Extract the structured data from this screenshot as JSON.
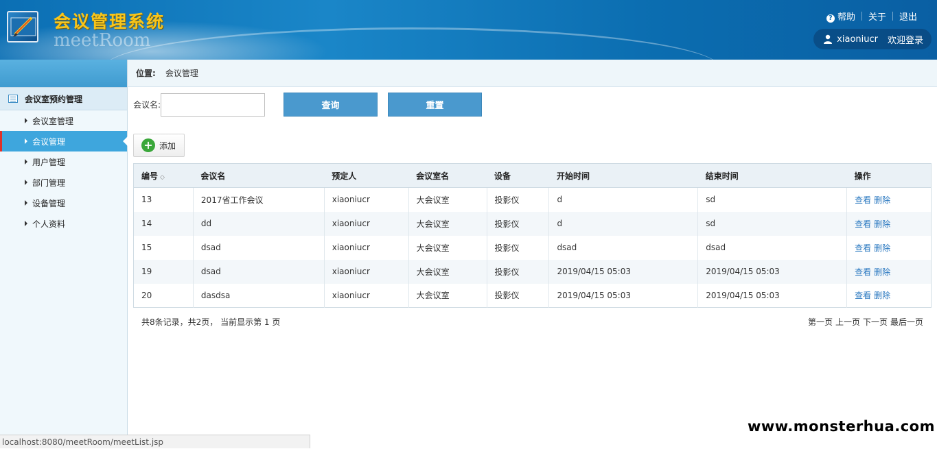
{
  "header": {
    "title": "会议管理系统",
    "subtitle": "meetRoom",
    "links": {
      "help": "帮助",
      "about": "关于",
      "logout": "退出"
    },
    "user": {
      "name": "xiaoniucr",
      "welcome": "欢迎登录"
    }
  },
  "sidebar": {
    "group_label": "会议室预约管理",
    "items": [
      {
        "label": "会议室管理"
      },
      {
        "label": "会议管理"
      },
      {
        "label": "用户管理"
      },
      {
        "label": "部门管理"
      },
      {
        "label": "设备管理"
      },
      {
        "label": "个人资料"
      }
    ],
    "active_index": 1
  },
  "breadcrumb": {
    "label": "位置:",
    "current": "会议管理"
  },
  "search": {
    "label": "会议名:",
    "value": "",
    "query_button": "查询",
    "reset_button": "重置"
  },
  "toolbar": {
    "add_label": "添加"
  },
  "table": {
    "columns": [
      "编号",
      "会议名",
      "预定人",
      "会议室名",
      "设备",
      "开始时间",
      "结束时间",
      "操作"
    ],
    "sort_icon": "◇",
    "rows": [
      {
        "id": "13",
        "name": "2017省工作会议",
        "booker": "xiaoniucr",
        "room": "大会议室",
        "device": "投影仪",
        "start": "d",
        "end": "sd"
      },
      {
        "id": "14",
        "name": "dd",
        "booker": "xiaoniucr",
        "room": "大会议室",
        "device": "投影仪",
        "start": "d",
        "end": "sd"
      },
      {
        "id": "15",
        "name": "dsad",
        "booker": "xiaoniucr",
        "room": "大会议室",
        "device": "投影仪",
        "start": "dsad",
        "end": "dsad"
      },
      {
        "id": "19",
        "name": "dsad",
        "booker": "xiaoniucr",
        "room": "大会议室",
        "device": "投影仪",
        "start": "2019/04/15 05:03",
        "end": "2019/04/15 05:03"
      },
      {
        "id": "20",
        "name": "dasdsa",
        "booker": "xiaoniucr",
        "room": "大会议室",
        "device": "投影仪",
        "start": "2019/04/15 05:03",
        "end": "2019/04/15 05:03"
      }
    ],
    "actions": {
      "view": "查看",
      "delete": "删除"
    }
  },
  "pager": {
    "summary": "共8条记录，共2页， 当前显示第 1 页",
    "first": "第一页",
    "prev": "上一页",
    "next": "下一页",
    "last": "最后一页"
  },
  "status_bar": {
    "url": "localhost:8080/meetRoom/meetList.jsp"
  },
  "watermark": "www.monsterhua.com",
  "colors": {
    "header_blue": "#0b6fb4",
    "active_item": "#3ea6dd",
    "button_blue": "#4a99ce",
    "title_gold": "#f7c51c",
    "link_blue": "#2a78c0"
  }
}
